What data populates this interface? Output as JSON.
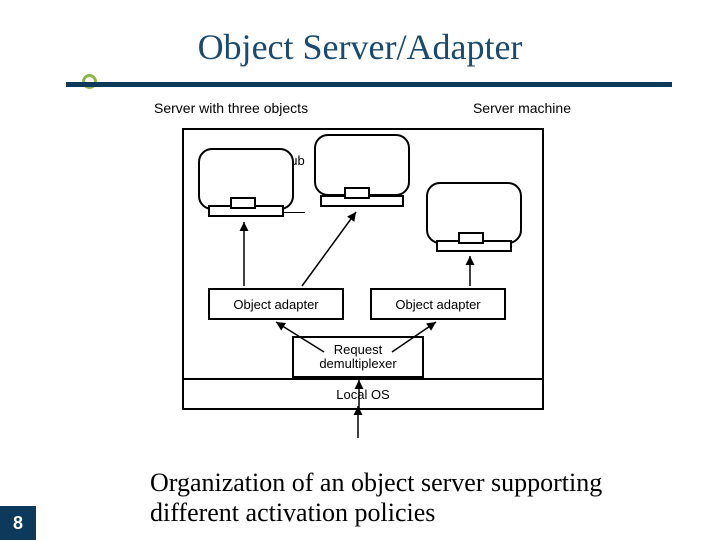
{
  "title": "Object Server/Adapter",
  "page_number": "8",
  "caption": "Organization of an object server supporting different activation policies",
  "diagram": {
    "header_left": "Server with three objects",
    "header_right": "Server machine",
    "skeleton_label": "Object's stub\n(skeleton)",
    "adapter_label": "Object adapter",
    "demux_label": "Request\ndemultiplexer",
    "localos_label": "Local OS"
  }
}
